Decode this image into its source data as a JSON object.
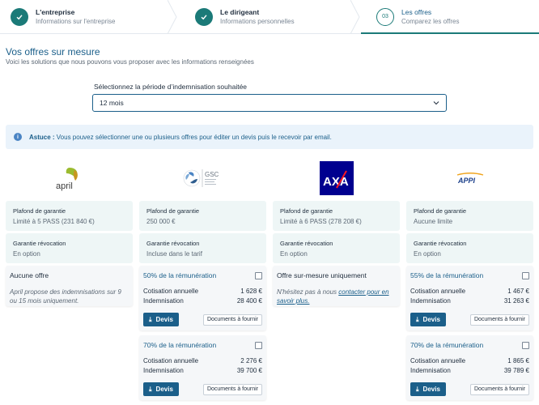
{
  "stepper": [
    {
      "title": "L'entreprise",
      "subtitle": "Informations sur l'entreprise",
      "status": "done"
    },
    {
      "title": "Le dirigeant",
      "subtitle": "Informations personnelles",
      "status": "done"
    },
    {
      "title": "Les offres",
      "subtitle": "Comparez les offres",
      "number": "03",
      "status": "current"
    }
  ],
  "header": {
    "title": "Vos offres sur mesure",
    "subtitle": "Voici les solutions que nous pouvons vous proposer avec les informations renseignées"
  },
  "period": {
    "label": "Sélectionnez la période d’indemnisation souhaitée",
    "value": "12 mois"
  },
  "tip": {
    "prefix": "Astuce :",
    "text": " Vous pouvez sélectionner une ou plusieurs offres pour éditer un devis puis le recevoir par email."
  },
  "labels": {
    "plafond": "Plafond de garantie",
    "revocation": "Garantie révocation",
    "cotisation": "Cotisation annuelle",
    "indemnisation": "Indemnisation",
    "devis": "Devis",
    "documents": "Documents à fournir"
  },
  "insurers": [
    {
      "name": "april",
      "plafond": "Limité à 5 PASS (231 840 €)",
      "revocation": "En option",
      "no_offer_title": "Aucune offre",
      "no_offer_note": "April propose des indemnisations sur 9 ou 15 mois uniquement."
    },
    {
      "name": "GSC",
      "plafond": "250 000 €",
      "revocation": "Incluse dans le tarif",
      "offers": [
        {
          "title": "50% de la rémunération",
          "cotisation": "1 628 €",
          "indemnisation": "28 400 €"
        },
        {
          "title": "70% de la rémunération",
          "cotisation": "2 276 €",
          "indemnisation": "39 700 €"
        }
      ]
    },
    {
      "name": "AXA",
      "plafond": "Limité à 6 PASS (278 208 €)",
      "revocation": "En option",
      "custom_title": "Offre sur-mesure uniquement",
      "custom_note_prefix": "N'hésitez pas à nous ",
      "custom_note_link": "contacter pour en savoir plus."
    },
    {
      "name": "APPI",
      "plafond": "Aucune limite",
      "revocation": "En option",
      "offers": [
        {
          "title": "55% de la rémunération",
          "cotisation": "1 467 €",
          "indemnisation": "31 263 €"
        },
        {
          "title": "70% de la rémunération",
          "cotisation": "1 865 €",
          "indemnisation": "39 789 €"
        }
      ]
    }
  ],
  "colors": {
    "accent": "#1b7a78",
    "primary": "#1b5f8a",
    "axa_blue": "#00008f",
    "axa_red": "#ff1721"
  }
}
